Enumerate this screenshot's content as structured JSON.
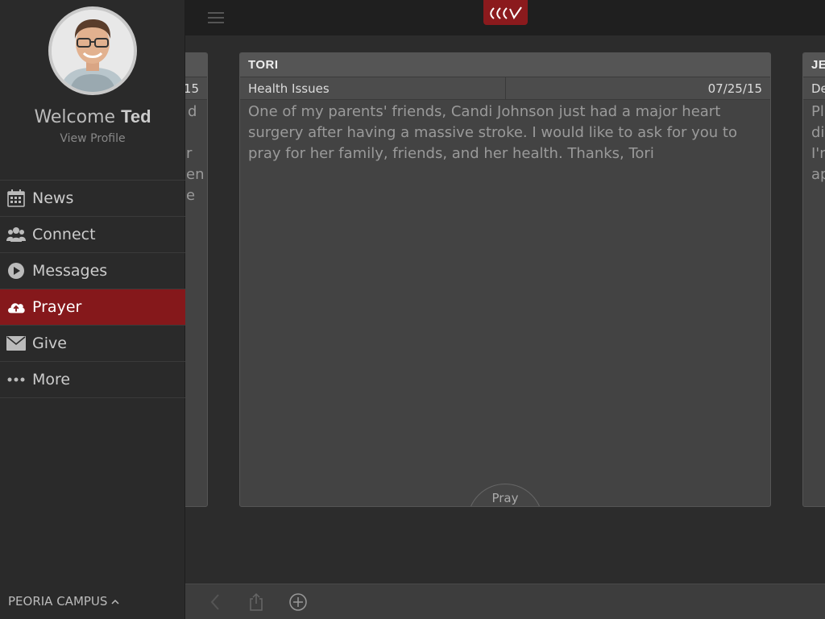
{
  "drawer": {
    "welcome_prefix": "Welcome",
    "user_name": "Ted",
    "view_profile": "View Profile",
    "menu": [
      {
        "label": "News",
        "icon": "calendar-icon"
      },
      {
        "label": "Connect",
        "icon": "people-icon"
      },
      {
        "label": "Messages",
        "icon": "play-circle-icon"
      },
      {
        "label": "Prayer",
        "icon": "cloud-upload-icon"
      },
      {
        "label": "Give",
        "icon": "envelope-icon"
      },
      {
        "label": "More",
        "icon": "more-dots-icon"
      }
    ],
    "active_item": "Prayer",
    "campus": "PEORIA CAMPUS"
  },
  "cards": {
    "left": {
      "date_fragment": "15",
      "text_fragments": [
        "d",
        "",
        "r",
        "en",
        "e"
      ]
    },
    "main": {
      "name": "TORI",
      "category": "Health Issues",
      "date": "07/25/15",
      "body": "One of my parents' friends, Candi Johnson just had a major heart surgery after having a massive stroke. I would like to ask for you to pray for her family, friends, and her health.  Thanks, Tori",
      "pray_label": "Pray"
    },
    "right": {
      "name_fragment": "JEI",
      "category_fragment": "De",
      "text_fragments": [
        "Pl",
        "dis",
        "I'n",
        "ap"
      ]
    }
  },
  "colors": {
    "accent": "#85181b",
    "drawer_bg": "#2a2a2a",
    "card_bg": "#434343"
  }
}
